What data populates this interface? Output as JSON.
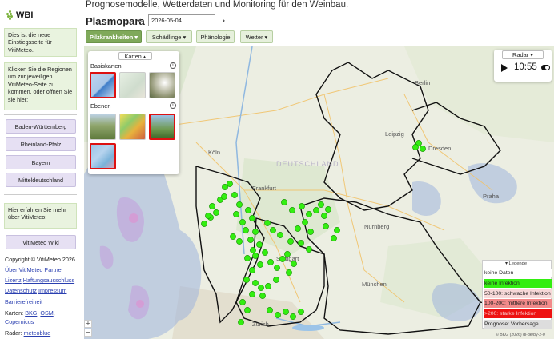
{
  "app_title": "Prognosemodelle, Wetterdaten und Monitoring für den Weinbau.",
  "logo": {
    "text": "WBI"
  },
  "sidebar": {
    "intro": "Dies ist die neue Einstiegsseite für VitiMeteo.",
    "instructions": "Klicken Sie die Regionen um zur jeweiligen VitiMeteo-Seite zu kommen, oder öffnen Sie sie hier:",
    "regions": [
      "Baden-Württemberg",
      "Rheinland-Pfalz",
      "Bayern",
      "Mitteldeutschland"
    ],
    "more_info": "Hier erfahren Sie mehr über VitiMeteo:",
    "wiki_button": "VitiMeteo Wiki",
    "copyright": "Copyright © VitiMeteo 2026",
    "links": {
      "about": "Über VitiMeteo",
      "partner": "Partner",
      "impressum_short": "Lizenz",
      "liability": "Haftungsausschluss",
      "privacy": "Datenschutz",
      "impressum": "Impressum",
      "accessibility": "Barrierefreiheit"
    },
    "maps_label": "Karten:",
    "maps_links": [
      "BKG",
      "OSM",
      "Copernicus"
    ],
    "radar_label": "Radar:",
    "radar_link": "meteoblue"
  },
  "header": {
    "model_title": "Plasmopara",
    "prev_arrow": "‹",
    "next_arrow": "›",
    "date_value": "2026-05-04",
    "tabs": [
      {
        "label": "Pilzkrankheiten ▾",
        "active": true
      },
      {
        "label": "Schädlinge ▾",
        "active": false
      },
      {
        "label": "Phänologie",
        "active": false
      },
      {
        "label": "Wetter ▾",
        "active": false
      }
    ]
  },
  "karten_panel": {
    "header": "Karten ▴",
    "basiskarten_label": "Basiskarten",
    "ebenen_label": "Ebenen",
    "info_icon": "i"
  },
  "radar_panel": {
    "header": "Radar ▾",
    "time": "10:55"
  },
  "map_labels": {
    "city_berlin": "Berlin",
    "city_dresden": "Dresden",
    "city_frankfurt": "Frankfurt",
    "city_stuttgart": "Stuttgart",
    "city_munchen": "München",
    "city_nurnberg": "Nürnberg",
    "city_koln": "Köln",
    "city_leipzig": "Leipzig",
    "city_praha": "Praha",
    "city_zurich": "Zürich",
    "country": "DEUTSCHLAND"
  },
  "legend": {
    "title": "▾ Legende",
    "items": [
      {
        "label": "keine Daten",
        "color": "#ffffff",
        "text_color": "#222222"
      },
      {
        "label": "keine Infektion",
        "color": "#33ee11",
        "text_color": "#222222"
      },
      {
        "label": "50-100: schwache Infektion",
        "color": "#f7d8d8",
        "text_color": "#222222"
      },
      {
        "label": "100-200: mittlere Infektion",
        "color": "#f28a8a",
        "text_color": "#222222"
      },
      {
        "label": ">200: starke Infektion",
        "color": "#ee1111",
        "text_color": "#f7c9c9"
      },
      {
        "label": "Prognose: Vorhersage",
        "color": "#dddddd",
        "text_color": "#222222"
      }
    ]
  },
  "attribution": "© BKG (2026) dl-de/by-2-0",
  "colors": {
    "station_fill": "#33ee11",
    "station_stroke": "#1f9a0a",
    "region_border": "#111111",
    "tab_active": "#7fa95a"
  }
}
